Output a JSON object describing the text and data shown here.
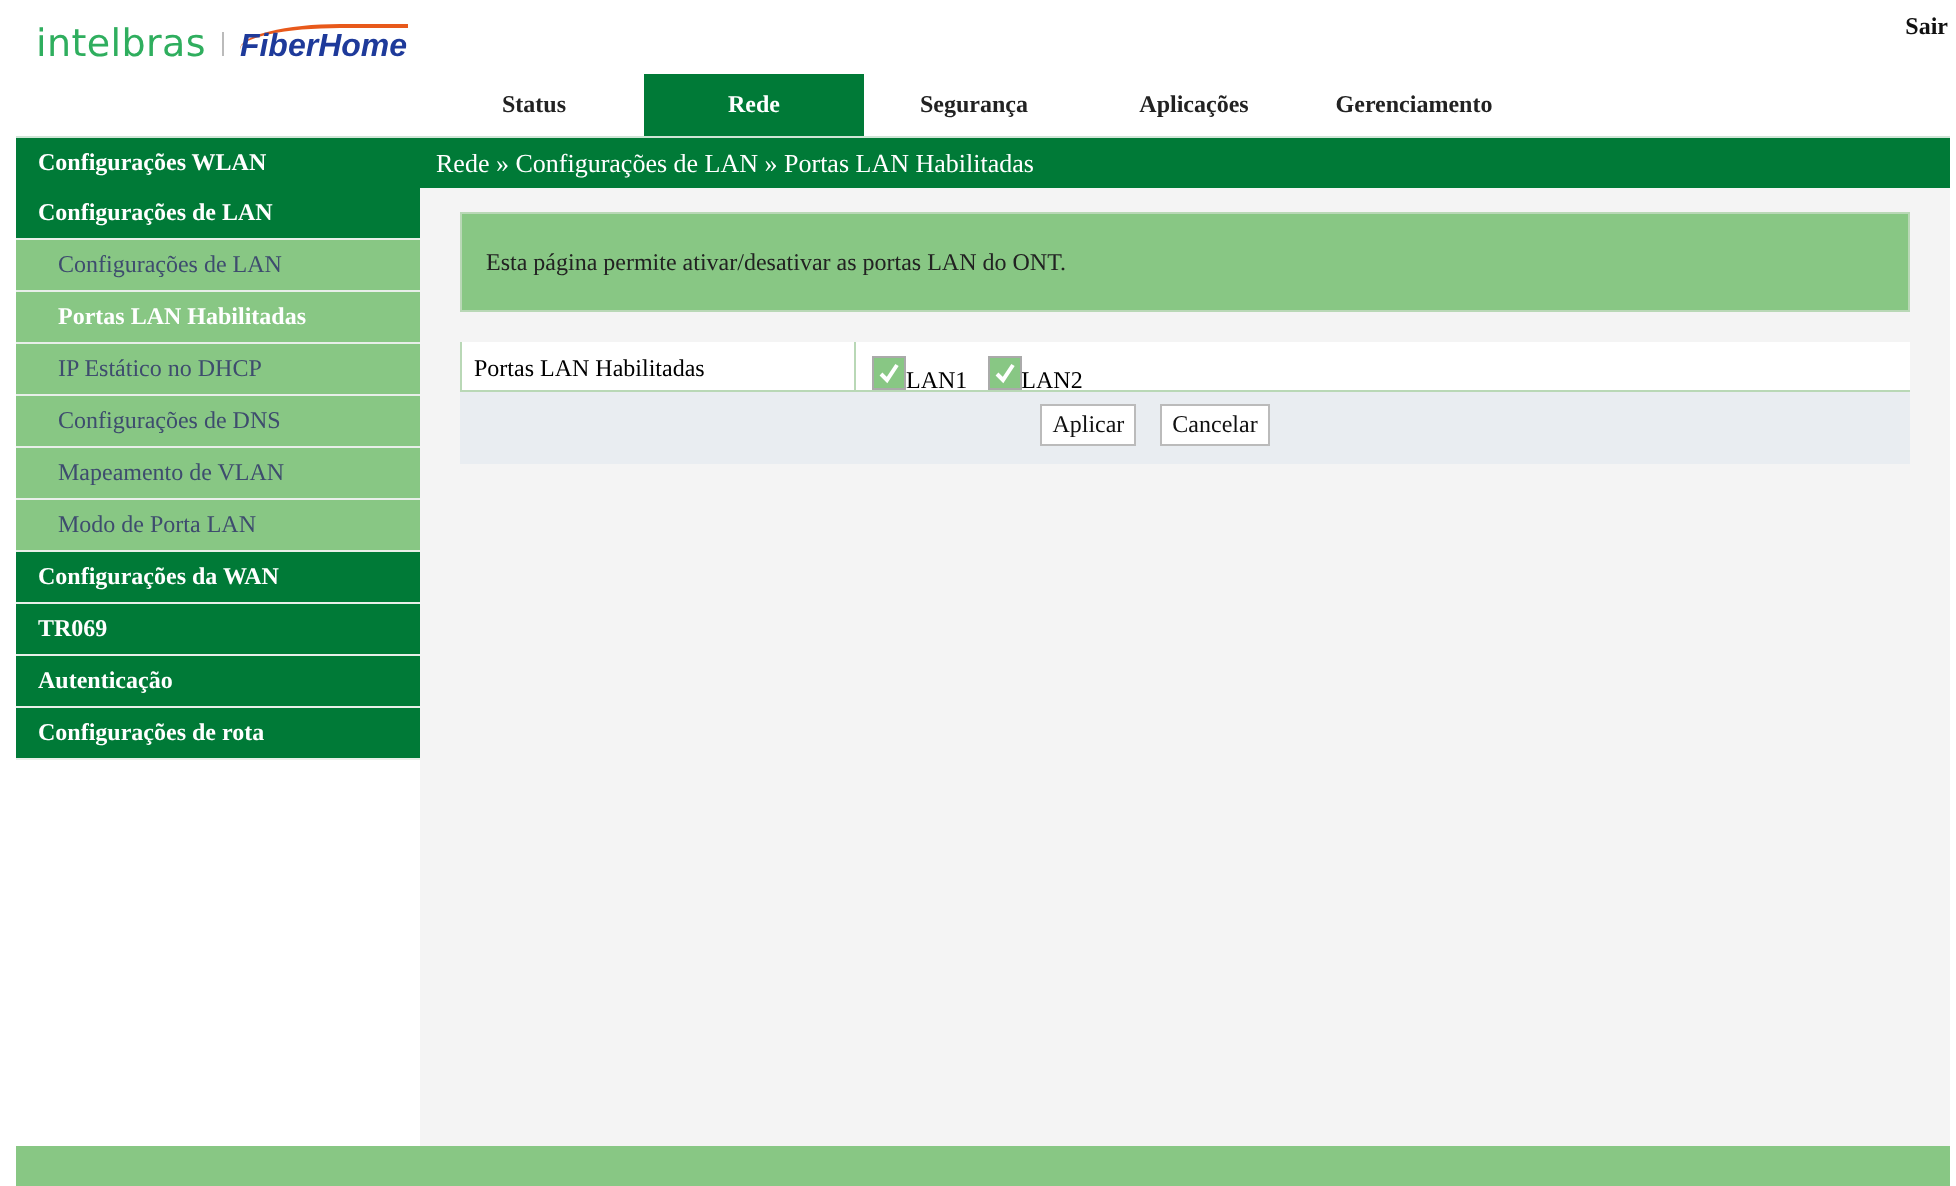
{
  "header": {
    "logo_primary": "intelbras",
    "logo_secondary": "FiberHome",
    "logout": "Sair"
  },
  "tabs": [
    {
      "label": "Status",
      "selected": false
    },
    {
      "label": "Rede",
      "selected": true
    },
    {
      "label": "Segurança",
      "selected": false
    },
    {
      "label": "Aplicações",
      "selected": false
    },
    {
      "label": "Gerenciamento",
      "selected": false
    }
  ],
  "sidebar": {
    "items": [
      {
        "label": "Configurações WLAN"
      },
      {
        "label": "Configurações de LAN",
        "children": [
          {
            "label": "Configurações de LAN",
            "selected": false
          },
          {
            "label": "Portas LAN Habilitadas",
            "selected": true
          },
          {
            "label": "IP Estático no DHCP",
            "selected": false
          },
          {
            "label": "Configurações de DNS",
            "selected": false
          },
          {
            "label": "Mapeamento de VLAN",
            "selected": false
          },
          {
            "label": "Modo de Porta LAN",
            "selected": false
          }
        ]
      },
      {
        "label": "Configurações da WAN"
      },
      {
        "label": "TR069"
      },
      {
        "label": "Autenticação"
      },
      {
        "label": "Configurações de rota"
      }
    ]
  },
  "breadcrumb": "Rede » Configurações de LAN » Portas LAN Habilitadas",
  "info": "Esta página permite ativar/desativar as portas LAN do ONT.",
  "form": {
    "label": "Portas LAN Habilitadas",
    "ports": [
      {
        "label": "LAN1",
        "checked": true
      },
      {
        "label": "LAN2",
        "checked": true
      }
    ]
  },
  "buttons": [
    "Aplicar",
    "Cancelar"
  ]
}
